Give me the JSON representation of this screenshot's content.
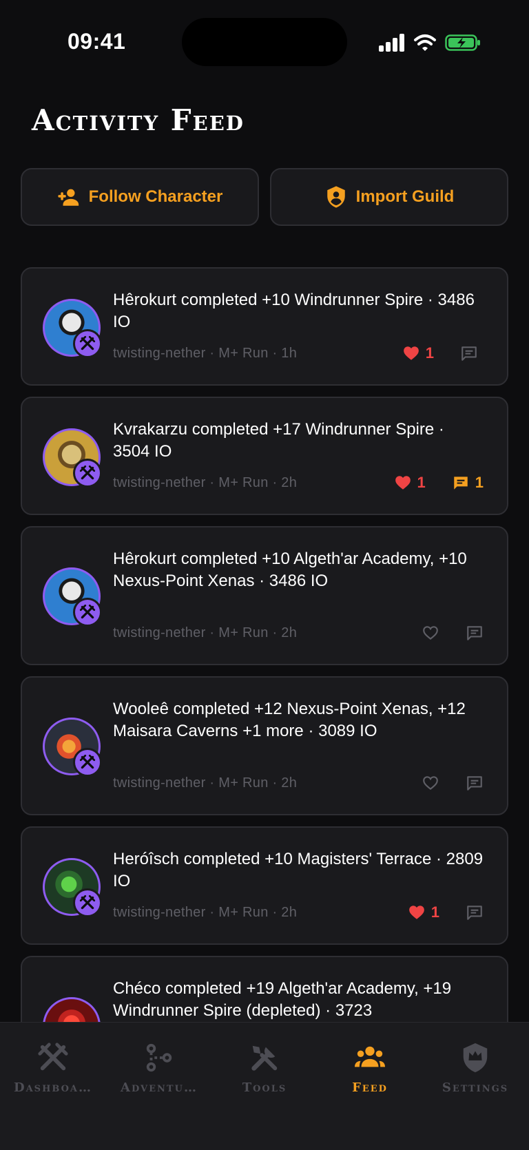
{
  "status_bar": {
    "time": "09:41"
  },
  "page": {
    "title": "Activity Feed"
  },
  "actions": {
    "follow_label": "Follow Character",
    "import_label": "Import Guild"
  },
  "feed": [
    {
      "text": "Hêrokurt completed +10 Windrunner Spire · 3486 IO",
      "meta": "twisting-nether · M+ Run · 1h",
      "likes": "1",
      "liked": true,
      "comments": "",
      "avatar_colors": [
        "#2f7fd0",
        "#e8e8e8",
        "#1a1a1a"
      ]
    },
    {
      "text": "Kvrakarzu completed +17 Windrunner Spire · 3504 IO",
      "meta": "twisting-nether · M+ Run · 2h",
      "likes": "1",
      "liked": true,
      "comments": "1",
      "avatar_colors": [
        "#caa03a",
        "#6b4d21",
        "#d9c07a"
      ]
    },
    {
      "text": "Hêrokurt completed +10 Algeth'ar Academy, +10 Nexus-Point Xenas · 3486 IO",
      "meta": "twisting-nether · M+ Run · 2h",
      "likes": "",
      "liked": false,
      "comments": "",
      "avatar_colors": [
        "#2f7fd0",
        "#e8e8e8",
        "#1a1a1a"
      ]
    },
    {
      "text": "Wooleê completed +12 Nexus-Point Xenas, +12 Maisara Caverns +1 more · 3089 IO",
      "meta": "twisting-nether · M+ Run · 2h",
      "likes": "",
      "liked": false,
      "comments": "",
      "avatar_colors": [
        "#2a2f3c",
        "#e0522c",
        "#f3a53a"
      ]
    },
    {
      "text": "Heróîsch completed +10 Magisters' Terrace · 2809 IO",
      "meta": "twisting-nether · M+ Run · 2h",
      "likes": "1",
      "liked": true,
      "comments": "",
      "avatar_colors": [
        "#1d3a24",
        "#5fd14a",
        "#2c6b2e"
      ]
    },
    {
      "text": "Chéco completed +19 Algeth'ar Academy, +19 Windrunner Spire (depleted) · 3723",
      "meta": "",
      "likes": "",
      "liked": false,
      "comments": "",
      "avatar_colors": [
        "#c0231f",
        "#ff4a3a",
        "#6a0f0f"
      ]
    }
  ],
  "tabs": [
    {
      "label": "Dashboa…",
      "icon": "crossed-swords-icon",
      "active": false
    },
    {
      "label": "Adventu…",
      "icon": "route-icon",
      "active": false
    },
    {
      "label": "Tools",
      "icon": "tools-icon",
      "active": false
    },
    {
      "label": "Feed",
      "icon": "group-icon",
      "active": true
    },
    {
      "label": "Settings",
      "icon": "crown-shield-icon",
      "active": false
    }
  ],
  "colors": {
    "accent": "#f5a020",
    "like": "#ef4444",
    "badge": "#8e5cf0",
    "background": "#0d0d0f",
    "card": "#1a1a1d"
  }
}
